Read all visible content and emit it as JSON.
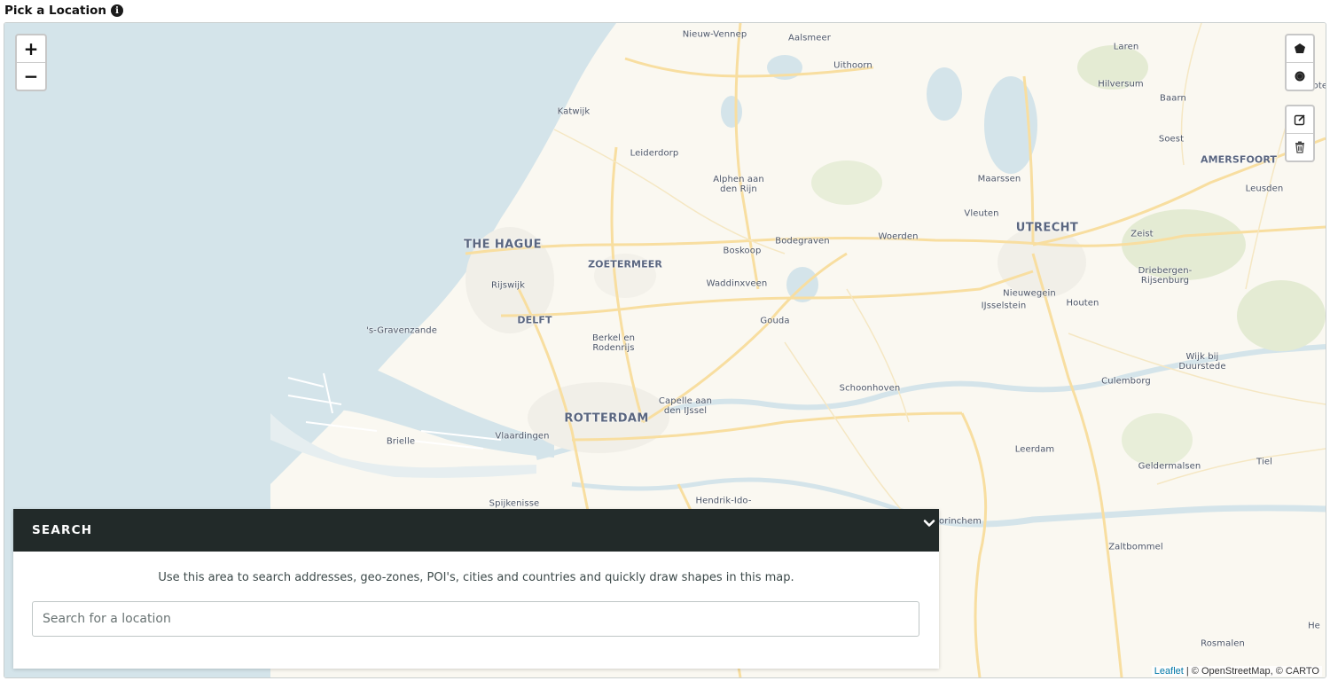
{
  "header": {
    "title": "Pick a Location",
    "info_icon": "info-icon"
  },
  "map": {
    "zoom_in_label": "+",
    "zoom_out_label": "−",
    "colors": {
      "water": "#d4e4ea",
      "land": "#faf8f1",
      "road": "#f8dea0",
      "park": "#dde8cc"
    },
    "places": [
      {
        "id": "nieuw-vennep",
        "label": "Nieuw-Vennep"
      },
      {
        "id": "aalsmeer",
        "label": "Aalsmeer"
      },
      {
        "id": "laren",
        "label": "Laren"
      },
      {
        "id": "uithoorn",
        "label": "Uithoorn"
      },
      {
        "id": "hilversum",
        "label": "Hilversum"
      },
      {
        "id": "katwijk",
        "label": "Katwijk"
      },
      {
        "id": "baarn",
        "label": "Baarn"
      },
      {
        "id": "leiderdorp",
        "label": "Leiderdorp"
      },
      {
        "id": "soest",
        "label": "Soest"
      },
      {
        "id": "amersfoort",
        "label": "AMERSFOORT"
      },
      {
        "id": "alphen",
        "label": "Alphen aan\nden Rijn"
      },
      {
        "id": "maarssen",
        "label": "Maarssen"
      },
      {
        "id": "leusden",
        "label": "Leusden"
      },
      {
        "id": "vleuten",
        "label": "Vleuten"
      },
      {
        "id": "the-hague",
        "label": "THE HAGUE"
      },
      {
        "id": "utrecht",
        "label": "UTRECHT"
      },
      {
        "id": "bodegraven",
        "label": "Bodegraven"
      },
      {
        "id": "woerden",
        "label": "Woerden"
      },
      {
        "id": "zeist",
        "label": "Zeist"
      },
      {
        "id": "boskoop",
        "label": "Boskoop"
      },
      {
        "id": "zoetermeer",
        "label": "ZOETERMEER"
      },
      {
        "id": "driebergen",
        "label": "Driebergen-\nRijsenburg"
      },
      {
        "id": "rijswijk",
        "label": "Rijswijk"
      },
      {
        "id": "waddinxveen",
        "label": "Waddinxveen"
      },
      {
        "id": "nieuwegein",
        "label": "Nieuwegein"
      },
      {
        "id": "houten",
        "label": "Houten"
      },
      {
        "id": "ijsselstein",
        "label": "IJsselstein"
      },
      {
        "id": "delft",
        "label": "DELFT"
      },
      {
        "id": "gouda",
        "label": "Gouda"
      },
      {
        "id": "gravenzande",
        "label": "'s-Gravenzande"
      },
      {
        "id": "berkel",
        "label": "Berkel en\nRodenrijs"
      },
      {
        "id": "wijk",
        "label": "Wijk bij\nDuurstede"
      },
      {
        "id": "culemborg",
        "label": "Culemborg"
      },
      {
        "id": "schoonhoven",
        "label": "Schoonhoven"
      },
      {
        "id": "capelle",
        "label": "Capelle aan\nden IJssel"
      },
      {
        "id": "rotterdam",
        "label": "ROTTERDAM"
      },
      {
        "id": "brielle",
        "label": "Brielle"
      },
      {
        "id": "vlaardingen",
        "label": "Vlaardingen"
      },
      {
        "id": "leerdam",
        "label": "Leerdam"
      },
      {
        "id": "geldermalsen",
        "label": "Geldermalsen"
      },
      {
        "id": "tiel",
        "label": "Tiel"
      },
      {
        "id": "spijkenisse",
        "label": "Spijkenisse"
      },
      {
        "id": "hendrik",
        "label": "Hendrik-Ido-"
      },
      {
        "id": "gorinchem",
        "label": "orinchem"
      },
      {
        "id": "zaltbommel",
        "label": "Zaltbommel"
      },
      {
        "id": "rosmalen",
        "label": "Rosmalen"
      },
      {
        "id": "he",
        "label": "He"
      },
      {
        "id": "bunschoten",
        "label": "unschoten"
      }
    ],
    "draw_tools": {
      "polygon_icon": "polygon-icon",
      "circle_icon": "circle-icon",
      "edit_icon": "edit-icon",
      "delete_icon": "trash-icon"
    },
    "attribution": {
      "leaflet": "Leaflet",
      "rest": " | © OpenStreetMap, © CARTO"
    }
  },
  "search": {
    "title": "SEARCH",
    "description": "Use this area to search addresses, geo-zones, POI's, cities and countries and quickly draw shapes in this map.",
    "input_placeholder": "Search for a location",
    "input_value": ""
  }
}
